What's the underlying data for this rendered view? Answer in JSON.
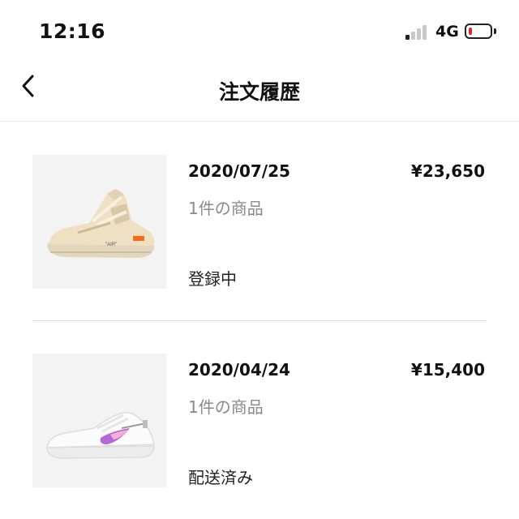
{
  "status_bar": {
    "time": "12:16",
    "network": "4G",
    "signal_bars_active": 1,
    "signal_bars_total": 4,
    "battery_level_fraction": 0.15,
    "battery_color": "#e0262d"
  },
  "header": {
    "title": "注文履歴",
    "back_icon": "chevron-left-icon"
  },
  "orders": [
    {
      "date": "2020/07/25",
      "price": "¥23,650",
      "count": "1件の商品",
      "status": "登録中",
      "image": "beige-sneaker-image",
      "image_caption": "\"AIR\""
    },
    {
      "date": "2020/04/24",
      "price": "¥15,400",
      "count": "1件の商品",
      "status": "配送済み",
      "image": "white-sneaker-image"
    }
  ]
}
